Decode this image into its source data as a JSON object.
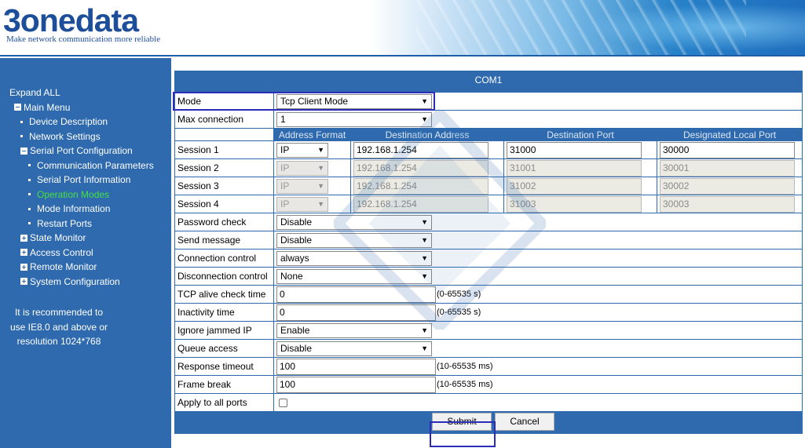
{
  "brand": {
    "logo": "3onedata",
    "tagline": "Make network communication more reliable"
  },
  "sidebar": {
    "expand_all": "Expand ALL",
    "main_menu": "Main Menu",
    "items": [
      {
        "label": "Device Description"
      },
      {
        "label": "Network Settings"
      },
      {
        "label": "Serial Port Configuration"
      },
      {
        "label": "Communication Parameters"
      },
      {
        "label": "Serial Port Information"
      },
      {
        "label": "Operation Modes"
      },
      {
        "label": "Mode Information"
      },
      {
        "label": "Restart Ports"
      },
      {
        "label": "State Monitor"
      },
      {
        "label": "Access Control"
      },
      {
        "label": "Remote Monitor"
      },
      {
        "label": "System Configuration"
      }
    ],
    "recommend": [
      "It is recommended to",
      "use IE8.0 and above or",
      "resolution 1024*768"
    ],
    "active_color": "#46e046"
  },
  "main": {
    "title": "COM1",
    "mode": {
      "label": "Mode",
      "value": "Tcp Client Mode"
    },
    "max_connection": {
      "label": "Max connection",
      "value": "1"
    },
    "columns": [
      "Address Format",
      "Destination Address",
      "Destination Port",
      "Designated Local Port"
    ],
    "sessions": [
      {
        "label": "Session 1",
        "format": "IP",
        "address": "192.168.1.254",
        "port": "31000",
        "local_port": "30000"
      },
      {
        "label": "Session 2",
        "format": "IP",
        "address": "192.168.1.254",
        "port": "31001",
        "local_port": "30001"
      },
      {
        "label": "Session 3",
        "format": "IP",
        "address": "192.168.1.254",
        "port": "31002",
        "local_port": "30002"
      },
      {
        "label": "Session 4",
        "format": "IP",
        "address": "192.168.1.254",
        "port": "31003",
        "local_port": "30003"
      }
    ],
    "password_check": {
      "label": "Password check",
      "value": "Disable"
    },
    "send_message": {
      "label": "Send message",
      "value": "Disable"
    },
    "connection_control": {
      "label": "Connection control",
      "value": "always"
    },
    "disconnection_control": {
      "label": "Disconnection control",
      "value": "None"
    },
    "tcp_alive": {
      "label": "TCP alive check time",
      "value": "0",
      "hint": "(0-65535 s)"
    },
    "inactivity": {
      "label": "Inactivity time",
      "value": "0",
      "hint": "(0-65535 s)"
    },
    "ignore_jammed": {
      "label": "Ignore jammed IP",
      "value": "Enable"
    },
    "queue_access": {
      "label": "Queue access",
      "value": "Disable"
    },
    "response_timeout": {
      "label": "Response timeout",
      "value": "100",
      "hint": "(10-65535 ms)"
    },
    "frame_break": {
      "label": "Frame break",
      "value": "100",
      "hint": "(10-65535 ms)"
    },
    "apply_all": {
      "label": "Apply to all ports"
    },
    "submit": "Submit",
    "cancel": "Cancel"
  },
  "colors": {
    "nav_blue": "#2e6aad",
    "highlight": "#2c2cb8"
  }
}
